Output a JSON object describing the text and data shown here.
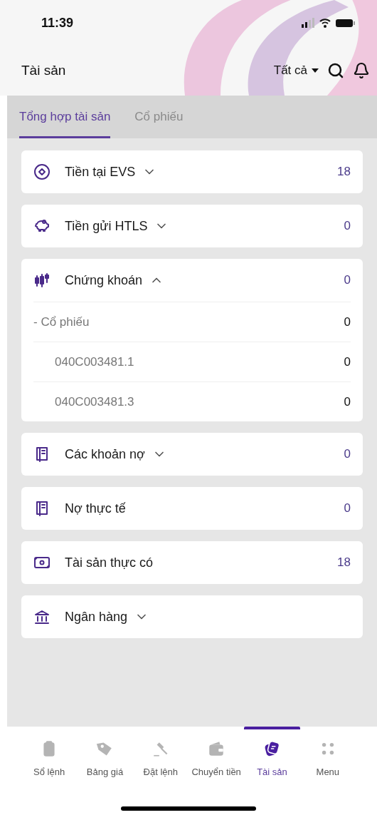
{
  "status_bar": {
    "time": "11:39"
  },
  "header": {
    "title": "Tài sản",
    "filter": "Tất cả"
  },
  "tabs": [
    {
      "label": "Tổng hợp tài sản",
      "selected": true
    },
    {
      "label": "Cổ phiếu",
      "selected": false
    }
  ],
  "cards": [
    {
      "label": "Tiền tại EVS",
      "expanded": false,
      "value": "18"
    },
    {
      "label": "Tiền gửi HTLS",
      "expanded": false,
      "value": "0"
    },
    {
      "label": "Chứng khoán",
      "expanded": true,
      "value": "0",
      "children": [
        {
          "label": "- Cổ phiếu",
          "value": "0",
          "children": [
            {
              "label": "040C003481.1",
              "value": "0"
            },
            {
              "label": "040C003481.3",
              "value": "0"
            }
          ]
        }
      ]
    },
    {
      "label": "Các khoản nợ",
      "expanded": false,
      "value": "0"
    },
    {
      "label": "Nợ thực tế",
      "value": "0"
    },
    {
      "label": "Tài sản thực có",
      "value": "18"
    },
    {
      "label": "Ngân hàng",
      "expanded": false
    }
  ],
  "nav": [
    {
      "label": "Sổ lệnh",
      "selected": false
    },
    {
      "label": "Bảng giá",
      "selected": false
    },
    {
      "label": "Đặt lệnh",
      "selected": false
    },
    {
      "label": "Chuyển tiền",
      "selected": false
    },
    {
      "label": "Tài sản",
      "selected": true
    },
    {
      "label": "Menu",
      "selected": false
    }
  ]
}
